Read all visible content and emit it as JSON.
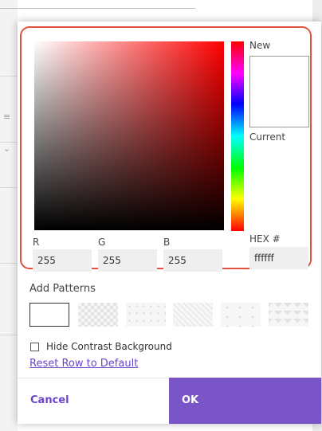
{
  "dialog": {
    "new_label": "New",
    "current_label": "Current",
    "hex_label": "HEX #",
    "rgb": {
      "r_label": "R",
      "g_label": "G",
      "b_label": "B",
      "r_value": "255",
      "g_value": "255",
      "b_value": "255"
    },
    "hex_value": "ffffff",
    "selected_hue": "#ff0000",
    "patterns_title": "Add Patterns",
    "patterns": [
      {
        "name": "solid",
        "selected": true
      },
      {
        "name": "checker",
        "selected": false
      },
      {
        "name": "dots",
        "selected": false
      },
      {
        "name": "diagonal",
        "selected": false
      },
      {
        "name": "sparse-dots",
        "selected": false
      },
      {
        "name": "zigzag",
        "selected": false
      }
    ],
    "hide_contrast_label": "Hide Contrast Background",
    "hide_contrast_checked": false,
    "reset_link": "Reset Row to Default",
    "cancel_label": "Cancel",
    "ok_label": "OK",
    "accent_color": "#7a55c8",
    "highlight_border_color": "#e0513f"
  }
}
